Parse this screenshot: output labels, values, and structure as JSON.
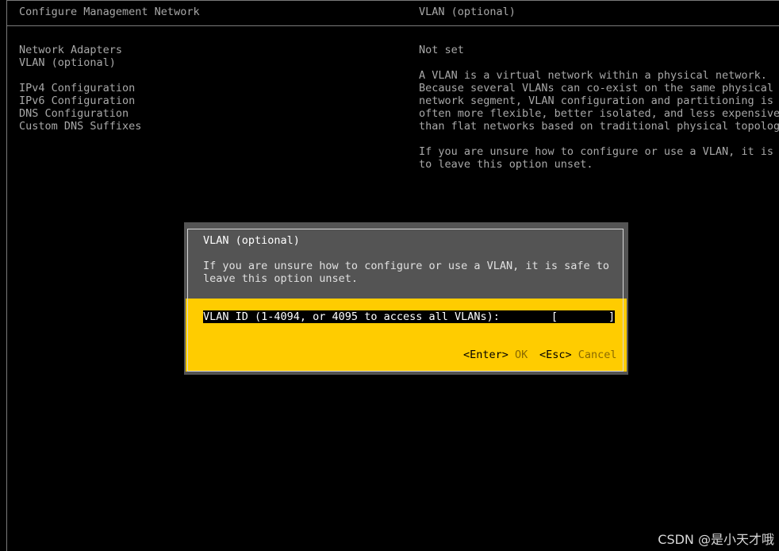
{
  "header": {
    "left_title": "Configure Management Network",
    "right_title": "VLAN (optional)"
  },
  "menu": {
    "items": [
      "Network Adapters",
      "VLAN (optional)",
      "IPv4 Configuration",
      "IPv6 Configuration",
      "DNS Configuration",
      "Custom DNS Suffixes"
    ]
  },
  "info": {
    "status": "Not set",
    "paragraph1": [
      "A VLAN is a virtual network within a physical network.",
      "Because several VLANs can co-exist on the same physical",
      "network segment, VLAN configuration and partitioning is",
      "often more flexible, better isolated, and less expensive",
      "than flat networks based on traditional physical topology"
    ],
    "paragraph2": [
      "If you are unsure how to configure or use a VLAN, it is s",
      "to leave this option unset."
    ]
  },
  "dialog": {
    "title": "VLAN (optional)",
    "description": [
      "If you are unsure how to configure or use a VLAN, it is safe to",
      "leave this option unset."
    ],
    "field_label": "VLAN ID (1-4094, or 4095 to access all VLANs):",
    "field_value": "",
    "field_open_bracket": "[",
    "field_close_bracket": "]",
    "ok_key": "<Enter>",
    "ok_label": "OK",
    "cancel_key": "<Esc>",
    "cancel_label": "Cancel"
  },
  "watermark": "CSDN @是小天才哦",
  "colors": {
    "background": "#000000",
    "text": "#a8a8a8",
    "dialog_header": "#545454",
    "dialog_body": "#ffcc00"
  }
}
